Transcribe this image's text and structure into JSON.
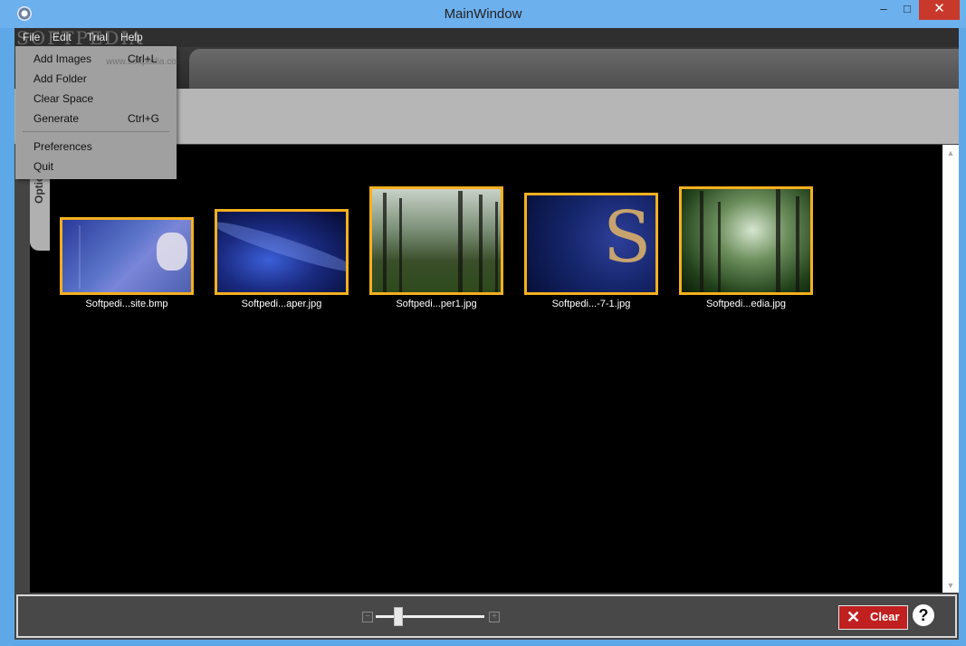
{
  "window": {
    "title": "MainWindow",
    "min_glyph": "–",
    "max_glyph": "□",
    "close_glyph": "✕"
  },
  "watermark": "SOFTPEDIA",
  "menubar": {
    "items": [
      "File",
      "Edit",
      "Trial",
      "Help"
    ]
  },
  "file_menu": {
    "items": [
      {
        "label": "Add Images",
        "shortcut": "Ctrl+L"
      },
      {
        "label": "Add Folder",
        "shortcut": ""
      },
      {
        "label": "Clear Space",
        "shortcut": ""
      },
      {
        "label": "Generate",
        "shortcut": "Ctrl+G"
      },
      {
        "label": "Preferences",
        "shortcut": ""
      },
      {
        "label": "Quit",
        "shortcut": ""
      }
    ],
    "url_watermark": "www.softpedia.com"
  },
  "side_tab": {
    "label": "Options"
  },
  "images": [
    {
      "name": "Softpedi...site.bmp"
    },
    {
      "name": "Softpedi...aper.jpg"
    },
    {
      "name": "Softpedi...per1.jpg"
    },
    {
      "name": "Softpedi...-7-1.jpg"
    },
    {
      "name": "Softpedi...edia.jpg"
    }
  ],
  "zoom": {
    "level": 0.2,
    "minus_glyph": "−",
    "plus_glyph": "+"
  },
  "bottom": {
    "clear_label": "Clear",
    "clear_icon_glyph": "✕",
    "help_glyph": "?"
  },
  "colors": {
    "thumb_border": "#f6b01e",
    "clear_button": "#c02020"
  }
}
